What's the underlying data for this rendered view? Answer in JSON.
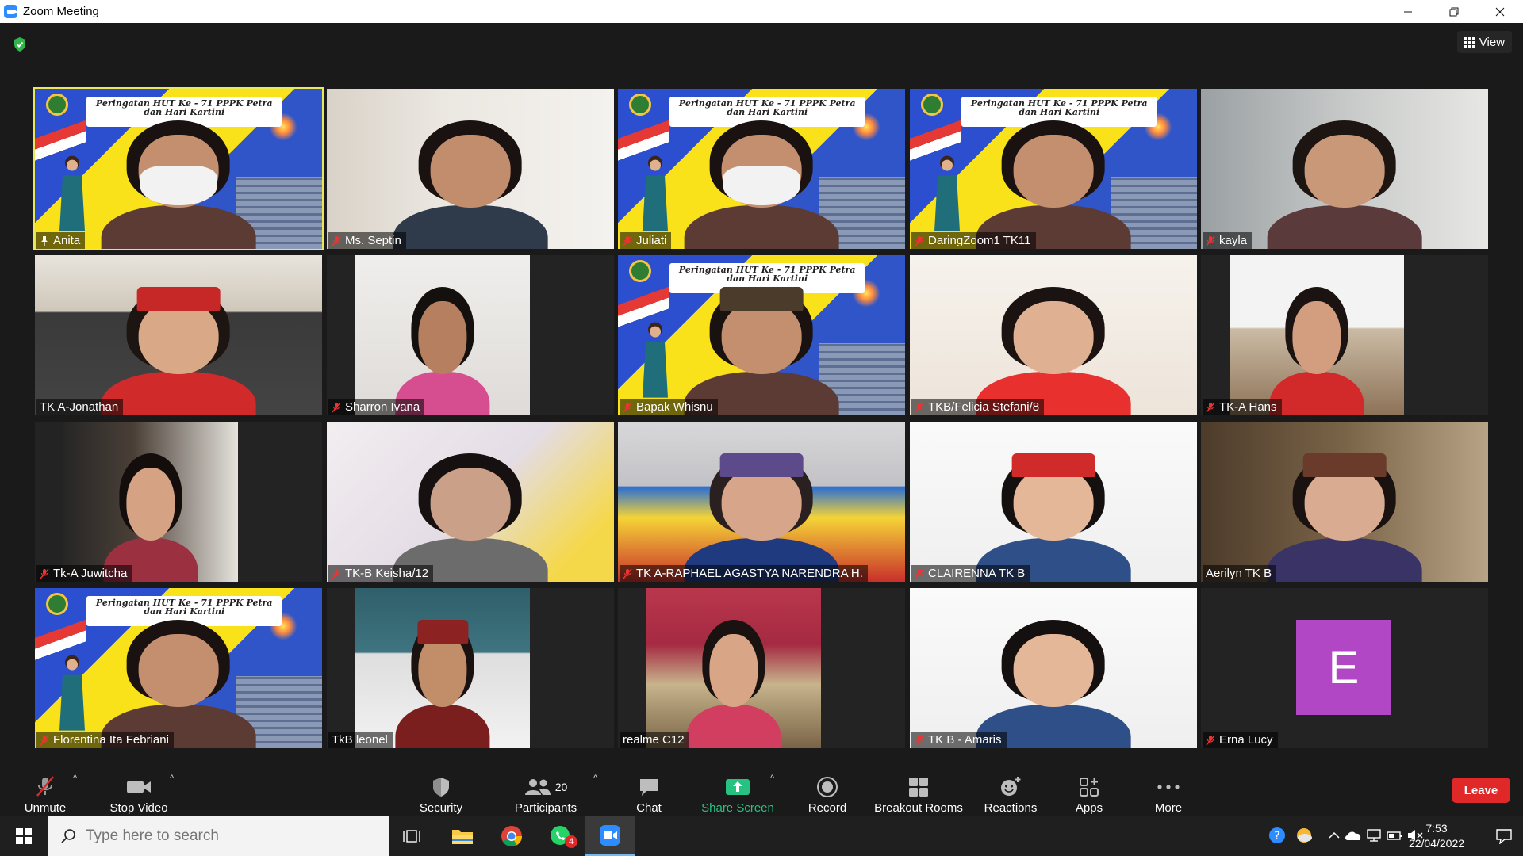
{
  "window": {
    "title": "Zoom Meeting"
  },
  "view": {
    "label": "View"
  },
  "banner": {
    "line1": "Peringatan HUT Ke - 71 PPPK Petra",
    "line2": "dan Hari Kartini"
  },
  "participants": [
    {
      "name": "Anita",
      "muted": false,
      "bg": "banner",
      "active": true
    },
    {
      "name": "Ms. Septin",
      "muted": true,
      "bg": "room"
    },
    {
      "name": "Juliati",
      "muted": true,
      "bg": "banner"
    },
    {
      "name": "DaringZoom1 TK11",
      "muted": true,
      "bg": "banner"
    },
    {
      "name": "kayla",
      "muted": true,
      "bg": "grey"
    },
    {
      "name": "TK A-Jonathan",
      "muted": false,
      "bg": "sofa"
    },
    {
      "name": "Sharron Ivana",
      "muted": true,
      "bg": "light"
    },
    {
      "name": "Bapak Whisnu",
      "muted": true,
      "bg": "banner"
    },
    {
      "name": "TKB/Felicia Stefani/8",
      "muted": true,
      "bg": "wall"
    },
    {
      "name": "TK-A Hans",
      "muted": true,
      "bg": "bed"
    },
    {
      "name": "Tk-A Juwitcha",
      "muted": true,
      "bg": "dark"
    },
    {
      "name": "TK-B Keisha/12",
      "muted": true,
      "bg": "tile"
    },
    {
      "name": "TK A-RAPHAEL AGASTYA NARENDRA H.",
      "muted": true,
      "bg": "colorful"
    },
    {
      "name": "CLAIRENNA TK B",
      "muted": true,
      "bg": "white"
    },
    {
      "name": "Aerilyn TK B",
      "muted": false,
      "bg": "brown"
    },
    {
      "name": "Florentina Ita Febriani",
      "muted": true,
      "bg": "banner"
    },
    {
      "name": "TkB leonel",
      "muted": false,
      "bg": "stairs"
    },
    {
      "name": "realme C12",
      "muted": false,
      "bg": "mat"
    },
    {
      "name": "TK B - Amaris",
      "muted": true,
      "bg": "white"
    },
    {
      "name": "Erna Lucy",
      "muted": true,
      "bg": "avatar",
      "initial": "E"
    }
  ],
  "toolbar": {
    "unmute": "Unmute",
    "stop_video": "Stop Video",
    "security": "Security",
    "participants": "Participants",
    "participants_count": "20",
    "chat": "Chat",
    "share_screen": "Share Screen",
    "record": "Record",
    "breakout": "Breakout Rooms",
    "reactions": "Reactions",
    "apps": "Apps",
    "more": "More",
    "leave": "Leave"
  },
  "taskbar": {
    "search_placeholder": "Type here to search",
    "whatsapp_badge": "4",
    "time": "7:53",
    "date": "22/04/2022"
  },
  "colors": {
    "active_speaker": "#e9e85a",
    "share_green": "#26c281",
    "leave_red": "#e02828",
    "avatar_purple": "#b147c5",
    "zoom_blue": "#2d8cff"
  }
}
